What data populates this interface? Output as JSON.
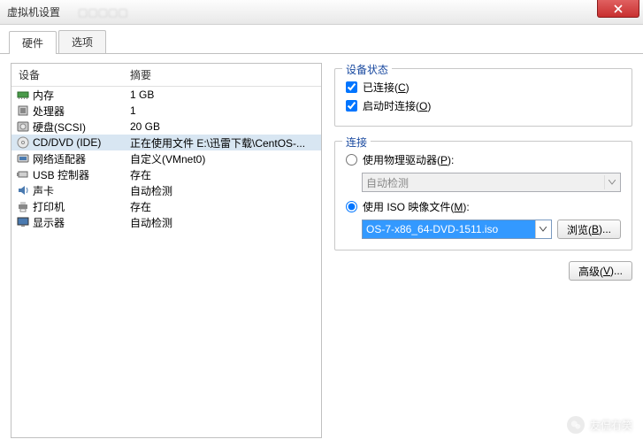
{
  "window": {
    "title": "虚拟机设置"
  },
  "tabs": {
    "hardware": "硬件",
    "options": "选项"
  },
  "columns": {
    "device": "设备",
    "summary": "摘要"
  },
  "devices": [
    {
      "icon": "memory",
      "name": "内存",
      "summary": "1 GB"
    },
    {
      "icon": "cpu",
      "name": "处理器",
      "summary": "1"
    },
    {
      "icon": "hdd",
      "name": "硬盘(SCSI)",
      "summary": "20 GB"
    },
    {
      "icon": "cd",
      "name": "CD/DVD (IDE)",
      "summary": "正在使用文件 E:\\迅雷下载\\CentOS-..."
    },
    {
      "icon": "net",
      "name": "网络适配器",
      "summary": "自定义(VMnet0)"
    },
    {
      "icon": "usb",
      "name": "USB 控制器",
      "summary": "存在"
    },
    {
      "icon": "sound",
      "name": "声卡",
      "summary": "自动检测"
    },
    {
      "icon": "printer",
      "name": "打印机",
      "summary": "存在"
    },
    {
      "icon": "display",
      "name": "显示器",
      "summary": "自动检测"
    }
  ],
  "selected_index": 3,
  "status_group": {
    "title": "设备状态",
    "connected": {
      "label": "已连接(",
      "key": "C",
      "tail": ")",
      "checked": true
    },
    "connect_on": {
      "label": "启动时连接(",
      "key": "O",
      "tail": ")",
      "checked": true
    }
  },
  "conn_group": {
    "title": "连接",
    "physical": {
      "label": "使用物理驱动器(",
      "key": "P",
      "tail": "):",
      "selected": false
    },
    "physical_value": "自动检测",
    "iso": {
      "label": "使用 ISO 映像文件(",
      "key": "M",
      "tail": "):",
      "selected": true
    },
    "iso_value": "OS-7-x86_64-DVD-1511.iso",
    "browse": {
      "label": "浏览(",
      "key": "B",
      "tail": ")..."
    }
  },
  "advanced": {
    "label": "高级(",
    "key": "V",
    "tail": ")..."
  },
  "watermark": "友侃有笑"
}
